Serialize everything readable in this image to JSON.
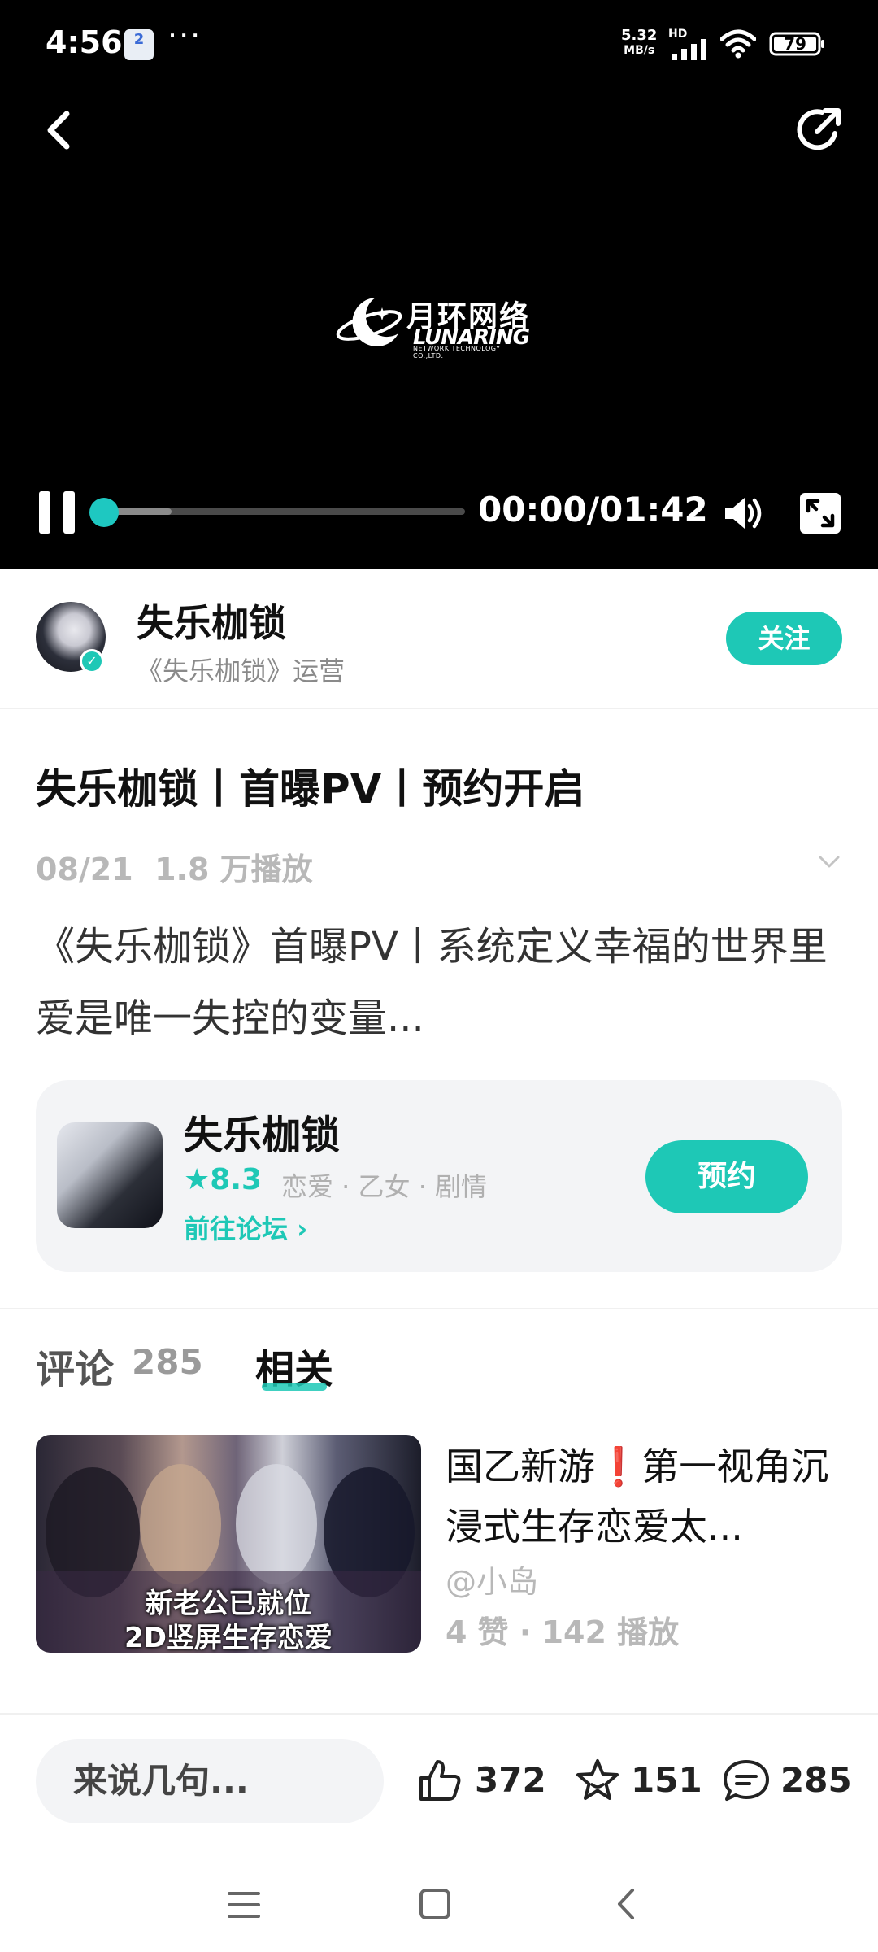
{
  "status_bar": {
    "time": "4:56",
    "app_badge": "2",
    "dots": "···",
    "net_speed_value": "5.32",
    "net_speed_unit": "MB/s",
    "network_type": "HD",
    "battery": "79"
  },
  "player": {
    "logo_cn": "月环网络",
    "logo_en": "LUNARING",
    "logo_sub": "NETWORK TECHNOLOGY CO.,LTD.",
    "time_display": "00:00/01:42",
    "progress_fraction": 0.0,
    "buffer_fraction": 0.19
  },
  "author": {
    "name": "失乐枷锁",
    "subtitle": "《失乐枷锁》运营",
    "follow_label": "关注"
  },
  "video": {
    "title": "失乐枷锁丨首曝PV丨预约开启",
    "date": "08/21",
    "plays": "1.8 万播放",
    "description": "《失乐枷锁》首曝PV丨系统定义幸福的世界里 爱是唯一失控的变量..."
  },
  "game_card": {
    "name": "失乐枷锁",
    "score": "★8.3",
    "tags": "恋爱 · 乙女 · 剧情",
    "forum_link": "前往论坛 ›",
    "reserve_label": "预约"
  },
  "tabs": {
    "comments_label": "评论",
    "comments_count": "285",
    "related_label": "相关"
  },
  "related": {
    "thumb_line1": "新老公已就位",
    "thumb_line2": "2D竖屏生存恋爱",
    "title": "国乙新游❗第一视角沉浸式生存恋爱太...",
    "author": "@小岛",
    "stats": "4 赞 · 142 播放"
  },
  "action_bar": {
    "comment_placeholder": "来说几句...",
    "likes": "372",
    "favorites": "151",
    "comments": "285"
  },
  "colors": {
    "accent": "#1ec8b6",
    "video_bg": "#000000",
    "card_bg": "#f3f4f6"
  },
  "icons": {
    "back": "chevron-left-icon",
    "share": "share-icon",
    "pause": "pause-icon",
    "volume": "volume-icon",
    "fullscreen": "fullscreen-icon",
    "like": "thumbs-up-icon",
    "favorite": "star-icon",
    "comment": "comment-bubble-icon"
  }
}
